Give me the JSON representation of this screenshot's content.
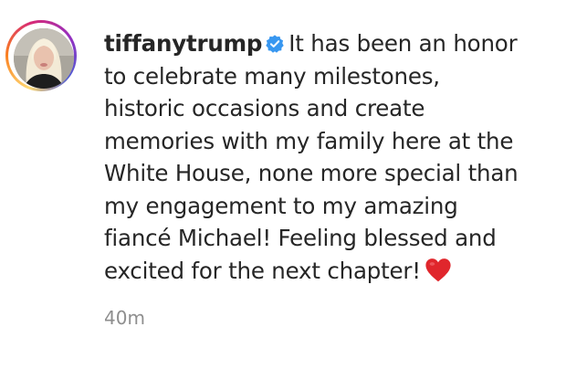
{
  "post": {
    "username": "tiffanytrump",
    "caption_lines": [
      "It has been an honor",
      "to celebrate many milestones,",
      "historic occasions and create",
      "memories with my family here at the",
      "White House, none more special than",
      "my engagement to my amazing",
      "fiancé Michael! Feeling blessed and",
      "excited for the next chapter!"
    ],
    "emoji": "❤️",
    "timestamp": "40m"
  },
  "icons": {
    "verified": "verified-badge-icon",
    "heart": "red-heart-emoji-icon"
  },
  "colors": {
    "text": "#262626",
    "muted": "#8e8e8e",
    "verified_blue": "#3897f0",
    "heart_red": "#e0262c"
  }
}
